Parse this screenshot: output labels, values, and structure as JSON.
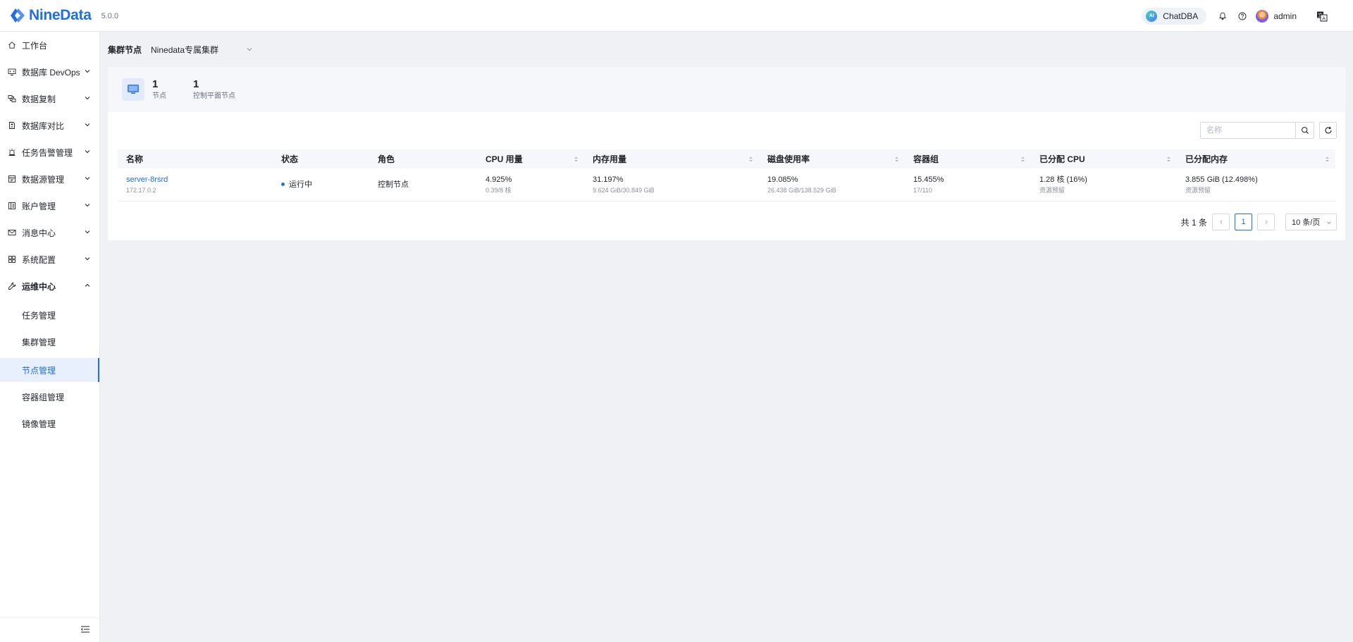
{
  "header": {
    "logo_text": "NineData",
    "version": "5.0.0",
    "chatdba_badge": "AI",
    "chatdba_label": "ChatDBA",
    "user_name": "admin"
  },
  "sidebar": {
    "items": [
      {
        "label": "工作台",
        "icon": "home-icon"
      },
      {
        "label": "数据库 DevOps",
        "icon": "monitor-code-icon"
      },
      {
        "label": "数据复制",
        "icon": "replicate-icon"
      },
      {
        "label": "数据库对比",
        "icon": "compare-icon"
      },
      {
        "label": "任务告警管理",
        "icon": "alarm-icon"
      },
      {
        "label": "数据源管理",
        "icon": "datasource-icon"
      },
      {
        "label": "账户管理",
        "icon": "account-icon"
      },
      {
        "label": "消息中心",
        "icon": "mail-icon"
      },
      {
        "label": "系统配置",
        "icon": "grid-icon"
      },
      {
        "label": "运维中心",
        "icon": "wrench-icon"
      }
    ],
    "sub_items": [
      {
        "label": "任务管理"
      },
      {
        "label": "集群管理"
      },
      {
        "label": "节点管理"
      },
      {
        "label": "容器组管理"
      },
      {
        "label": "镜像管理"
      }
    ]
  },
  "breadcrumb": {
    "label": "集群节点",
    "selected_cluster": "Ninedata专属集群"
  },
  "summary": {
    "nodes_value": "1",
    "nodes_label": "节点",
    "control_value": "1",
    "control_label": "控制平面节点"
  },
  "search": {
    "placeholder": "名称"
  },
  "table": {
    "headers": [
      "名称",
      "状态",
      "角色",
      "CPU 用量",
      "内存用量",
      "磁盘使用率",
      "容器组",
      "已分配 CPU",
      "已分配内存"
    ],
    "rows": [
      {
        "name": "server-8rsrd",
        "ip": "172.17.0.2",
        "status": "运行中",
        "role": "控制节点",
        "cpu_main": "4.925%",
        "cpu_sub": "0.39/8 核",
        "mem_main": "31.197%",
        "mem_sub": "9.624 GiB/30.849 GiB",
        "disk_main": "19.085%",
        "disk_sub": "26.438 GiB/138.529 GiB",
        "pods_main": "15.455%",
        "pods_sub": "17/110",
        "alloc_cpu_main": "1.28 核 (16%)",
        "alloc_cpu_sub": "资源预留",
        "alloc_mem_main": "3.855 GiB (12.498%)",
        "alloc_mem_sub": "资源预留"
      }
    ]
  },
  "pagination": {
    "total": "共 1 条",
    "current_page": "1",
    "page_size": "10 条/页"
  },
  "colors": {
    "primary": "#1f6fe5",
    "background": "#f0f1f5"
  }
}
